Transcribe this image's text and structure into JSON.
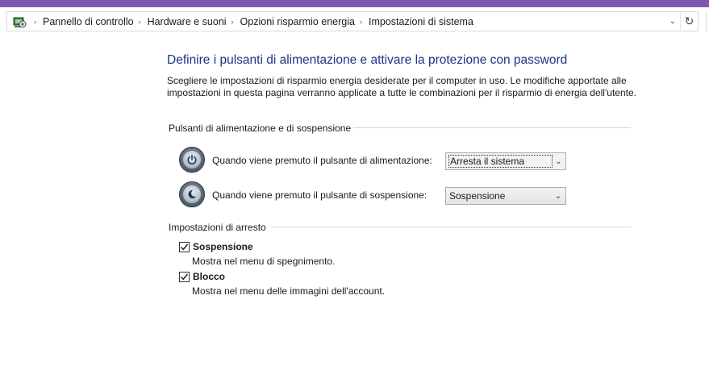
{
  "breadcrumb": {
    "items": [
      {
        "label": "Pannello di controllo"
      },
      {
        "label": "Hardware e suoni"
      },
      {
        "label": "Opzioni risparmio energia"
      },
      {
        "label": "Impostazioni di sistema"
      }
    ],
    "separator": "›"
  },
  "page": {
    "title": "Definire i pulsanti di alimentazione e attivare la protezione con password",
    "description": "Scegliere le impostazioni di risparmio energia desiderate per il computer in uso. Le modifiche apportate alle impostazioni in questa pagina verranno applicate a tutte le combinazioni per il risparmio di energia dell'utente."
  },
  "power_section": {
    "heading": "Pulsanti di alimentazione e di sospensione",
    "power_button": {
      "label": "Quando viene premuto il pulsante di alimentazione:",
      "value": "Arresta il sistema",
      "icon": "power-button-icon"
    },
    "sleep_button": {
      "label": "Quando viene premuto il pulsante di sospensione:",
      "value": "Sospensione",
      "icon": "sleep-button-icon"
    }
  },
  "shutdown_section": {
    "heading": "Impostazioni di arresto",
    "options": [
      {
        "label": "Sospensione",
        "description": "Mostra nel menu di spegnimento.",
        "checked": true
      },
      {
        "label": "Blocco",
        "description": "Mostra nel menu delle immagini dell'account.",
        "checked": true
      }
    ]
  },
  "colors": {
    "title_blue": "#1e3287",
    "accent_purple": "#7e57ad"
  }
}
